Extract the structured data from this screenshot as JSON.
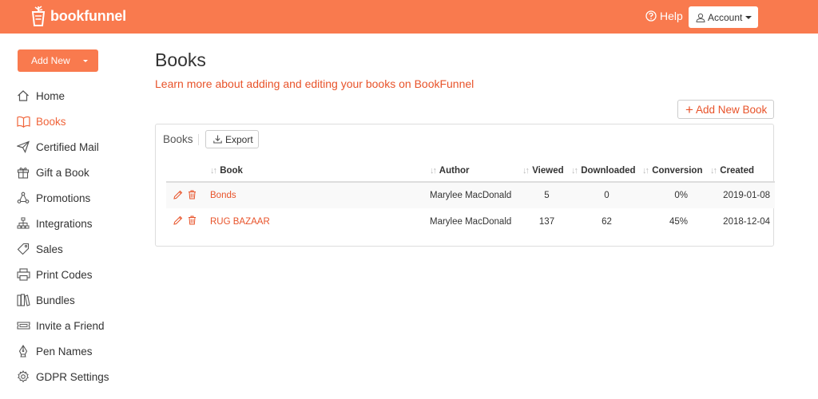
{
  "header": {
    "logo_text": "bookfunnel",
    "help_label": "Help",
    "account_label": "Account"
  },
  "sidebar": {
    "add_new_label": "Add New",
    "items": [
      {
        "label": "Home",
        "icon": "home-icon"
      },
      {
        "label": "Books",
        "icon": "book-icon",
        "active": true
      },
      {
        "label": "Certified Mail",
        "icon": "paper-plane-icon"
      },
      {
        "label": "Gift a Book",
        "icon": "gift-icon"
      },
      {
        "label": "Promotions",
        "icon": "promotions-icon"
      },
      {
        "label": "Integrations",
        "icon": "network-icon"
      },
      {
        "label": "Sales",
        "icon": "tag-icon"
      },
      {
        "label": "Print Codes",
        "icon": "printer-icon"
      },
      {
        "label": "Bundles",
        "icon": "bundles-icon"
      },
      {
        "label": "Invite a Friend",
        "icon": "ticket-icon"
      },
      {
        "label": "Pen Names",
        "icon": "pen-nib-icon"
      },
      {
        "label": "GDPR Settings",
        "icon": "gear-icon"
      }
    ]
  },
  "main": {
    "title": "Books",
    "learn_link": "Learn more about adding and editing your books on BookFunnel",
    "add_book_label": "Add New Book",
    "panel": {
      "title": "Books",
      "export_label": "Export"
    },
    "table": {
      "columns": [
        "Book",
        "Author",
        "Viewed",
        "Downloaded",
        "Conversion",
        "Created"
      ],
      "rows": [
        {
          "book": "Bonds",
          "author": "Marylee MacDonald",
          "viewed": "5",
          "downloaded": "0",
          "conversion": "0%",
          "created": "2019-01-08"
        },
        {
          "book": "RUG BAZAAR",
          "author": "Marylee MacDonald",
          "viewed": "137",
          "downloaded": "62",
          "conversion": "45%",
          "created": "2018-12-04"
        }
      ]
    }
  },
  "colors": {
    "brand": "#f97a4e",
    "link": "#e8532a"
  }
}
